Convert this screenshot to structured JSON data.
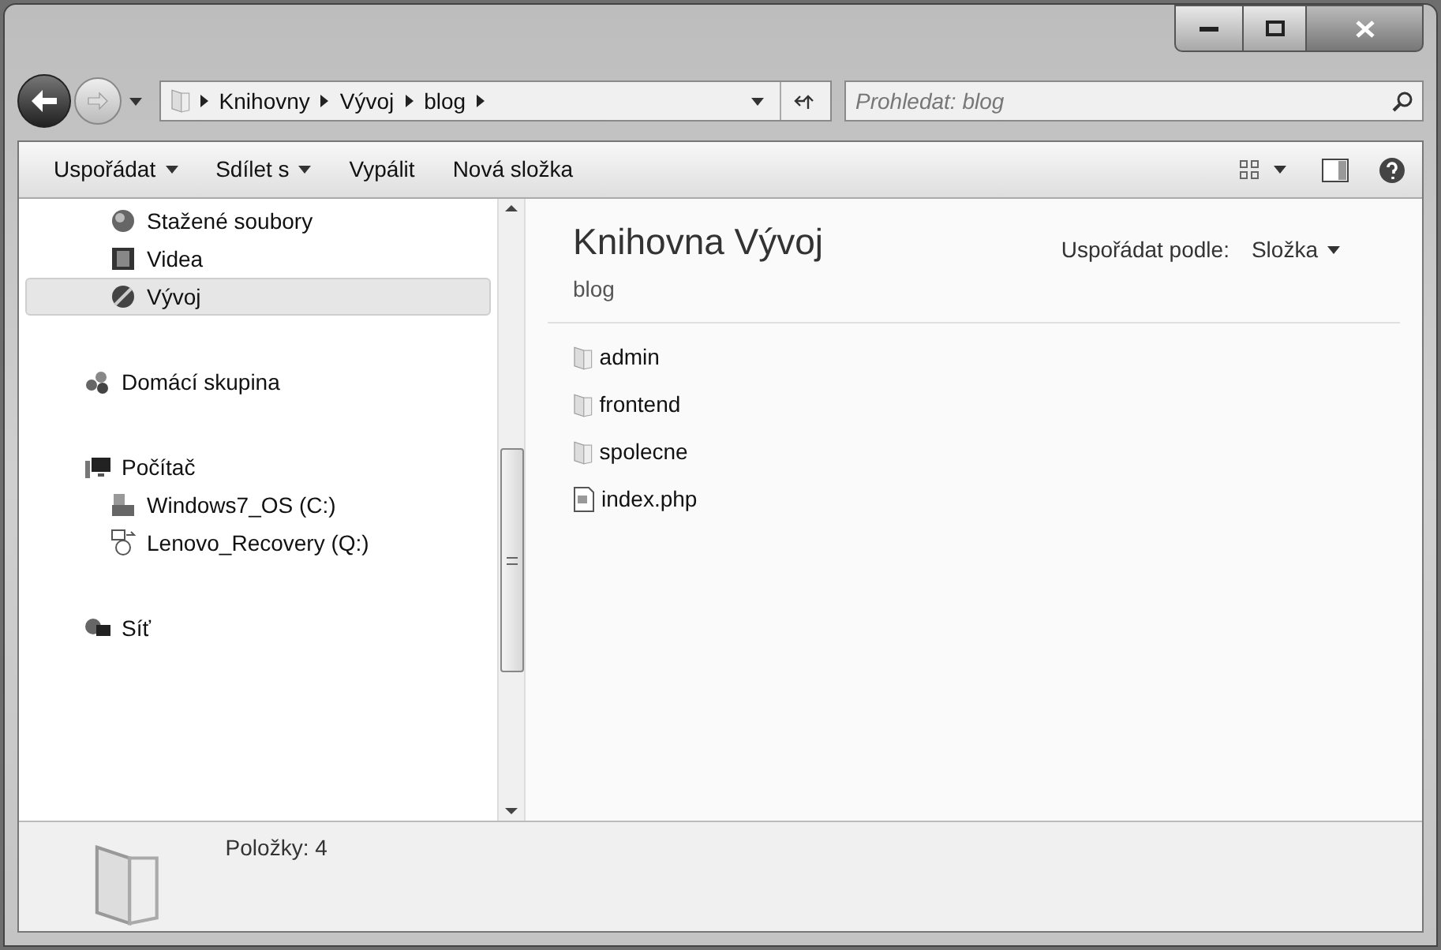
{
  "address_bar": {
    "path": [
      "Knihovny",
      "Vývoj",
      "blog"
    ]
  },
  "search": {
    "placeholder": "Prohledat: blog"
  },
  "toolbar": {
    "items": [
      {
        "label": "Uspořádat",
        "dropdown": true
      },
      {
        "label": "Sdílet s",
        "dropdown": true
      },
      {
        "label": "Vypálit",
        "dropdown": false
      },
      {
        "label": "Nová složka",
        "dropdown": false
      }
    ]
  },
  "sidebar": {
    "sections": [
      {
        "children": [
          {
            "label": "Stažené soubory",
            "kind": "downloads",
            "selected": false
          },
          {
            "label": "Videa",
            "kind": "videos",
            "selected": false
          },
          {
            "label": "Vývoj",
            "kind": "library",
            "selected": true
          }
        ]
      },
      {
        "label": "Domácí skupina",
        "kind": "homegroup",
        "selected": false
      },
      {
        "label": "Počítač",
        "kind": "computer",
        "selected": false,
        "children": [
          {
            "label": "Windows7_OS (C:)",
            "kind": "drive",
            "selected": false
          },
          {
            "label": "Lenovo_Recovery (Q:)",
            "kind": "recovery",
            "selected": false
          }
        ]
      },
      {
        "label": "Síť",
        "kind": "network",
        "selected": false
      }
    ]
  },
  "library": {
    "title": "Knihovna Vývoj",
    "subtitle": "blog",
    "arrange_label": "Uspořádat podle:",
    "arrange_value": "Složka"
  },
  "files": [
    {
      "name": "admin",
      "kind": "folder"
    },
    {
      "name": "frontend",
      "kind": "folder"
    },
    {
      "name": "spolecne",
      "kind": "folder"
    },
    {
      "name": "index.php",
      "kind": "file"
    }
  ],
  "status_bar": {
    "text": "Položky: 4"
  }
}
